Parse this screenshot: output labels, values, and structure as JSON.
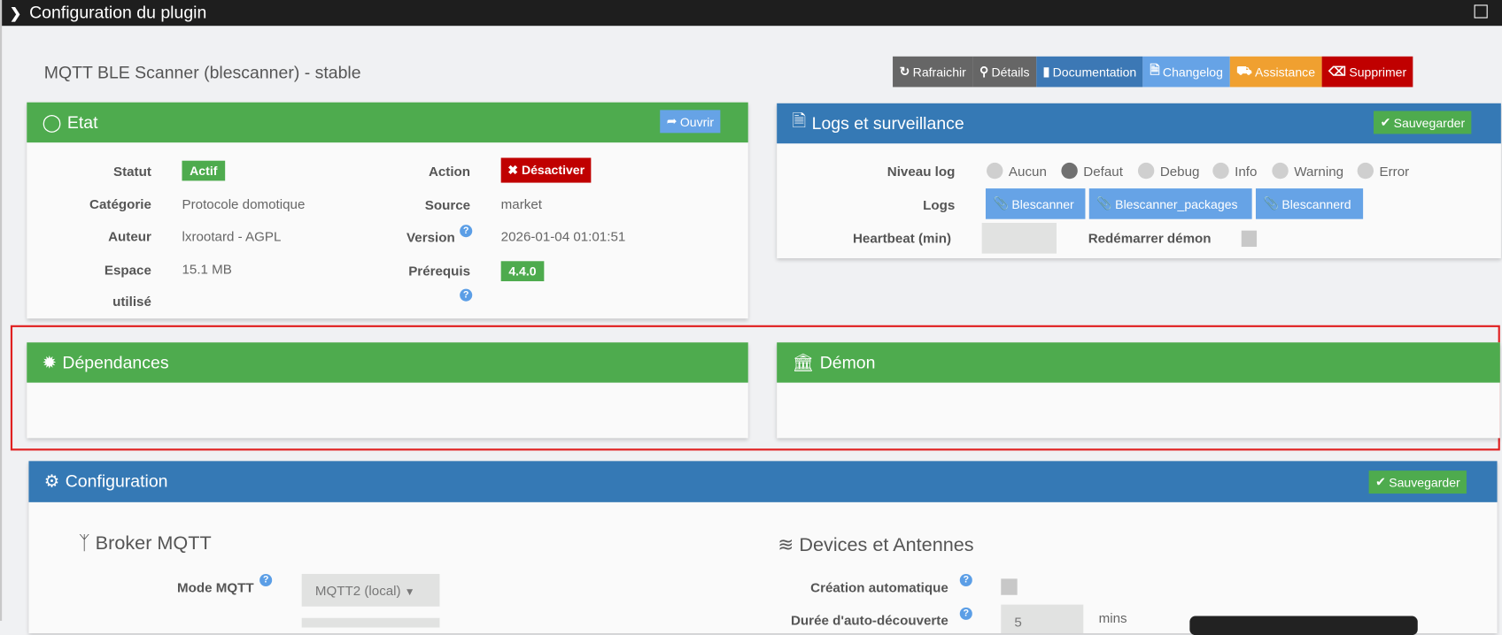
{
  "window": {
    "title": "Configuration du plugin"
  },
  "page_title": "MQTT BLE Scanner (blescanner) - stable",
  "toolbar": {
    "refresh": "Rafraichir",
    "details": "Détails",
    "documentation": "Documentation",
    "changelog": "Changelog",
    "assistance": "Assistance",
    "delete": "Supprimer"
  },
  "etat": {
    "title": "Etat",
    "open": "Ouvrir",
    "statut_label": "Statut",
    "statut": "Actif",
    "categorie_label": "Catégorie",
    "categorie": "Protocole domotique",
    "auteur_label": "Auteur",
    "auteur": "lxrootard - AGPL",
    "espace_label_1": "Espace",
    "espace_label_2": "utilisé",
    "espace": "15.1 MB",
    "action_label": "Action",
    "action": "Désactiver",
    "source_label": "Source",
    "source": "market",
    "version_label": "Version",
    "version": "2026-01-04 01:01:51",
    "prerequis_label": "Prérequis",
    "prerequis": "4.4.0"
  },
  "logs": {
    "title": "Logs et surveillance",
    "save": "Sauvegarder",
    "level_label": "Niveau log",
    "levels": [
      "Aucun",
      "Defaut",
      "Debug",
      "Info",
      "Warning",
      "Error"
    ],
    "selected_level": "Defaut",
    "logs_label": "Logs",
    "log_buttons": [
      "Blescanner",
      "Blescanner_packages",
      "Blescannerd"
    ],
    "heartbeat_label": "Heartbeat (min)",
    "restart_label": "Redémarrer démon"
  },
  "dependances": {
    "title": "Dépendances"
  },
  "demon": {
    "title": "Démon"
  },
  "configuration": {
    "title": "Configuration",
    "save": "Sauvegarder",
    "broker_title": "Broker MQTT",
    "mode_label": "Mode MQTT",
    "mode_value": "MQTT2 (local)",
    "devices_title": "Devices et Antennes",
    "auto_create_label": "Création automatique",
    "discovery_label": "Durée d'auto-découverte",
    "discovery_value": "5",
    "discovery_unit": "mins"
  },
  "colors": {
    "green": "#4eab4e",
    "blue": "#3579b5",
    "light_blue": "#66a3e6",
    "red": "#c00000",
    "orange": "#f0a030",
    "grey": "#666666"
  }
}
